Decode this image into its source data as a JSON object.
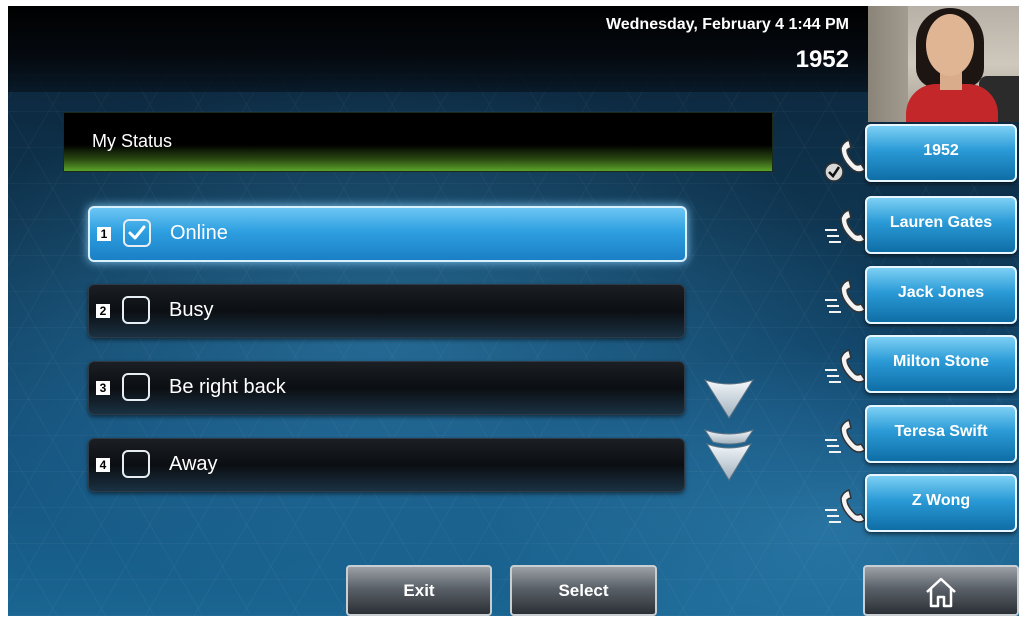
{
  "header": {
    "datetime": "Wednesday, February 4  1:44 PM",
    "extension": "1952"
  },
  "status_panel": {
    "title": "My Status",
    "options": [
      {
        "number": "1",
        "label": "Online",
        "checked": true
      },
      {
        "number": "2",
        "label": "Busy",
        "checked": false
      },
      {
        "number": "3",
        "label": "Be right back",
        "checked": false
      },
      {
        "number": "4",
        "label": "Away",
        "checked": false
      }
    ]
  },
  "lines": [
    {
      "label": "1952",
      "icon": "phone-registered-icon"
    },
    {
      "label": "Lauren Gates",
      "icon": "phone-handset-icon"
    },
    {
      "label": "Jack Jones",
      "icon": "phone-handset-icon"
    },
    {
      "label": "Milton Stone",
      "icon": "phone-handset-icon"
    },
    {
      "label": "Teresa Swift",
      "icon": "phone-handset-icon"
    },
    {
      "label": "Z Wong",
      "icon": "phone-handset-icon"
    }
  ],
  "softkeys": {
    "exit": "Exit",
    "select": "Select",
    "home_icon": "home-icon"
  },
  "colors": {
    "accent_blue": "#2e9fe0",
    "title_green": "#5aa32a"
  }
}
